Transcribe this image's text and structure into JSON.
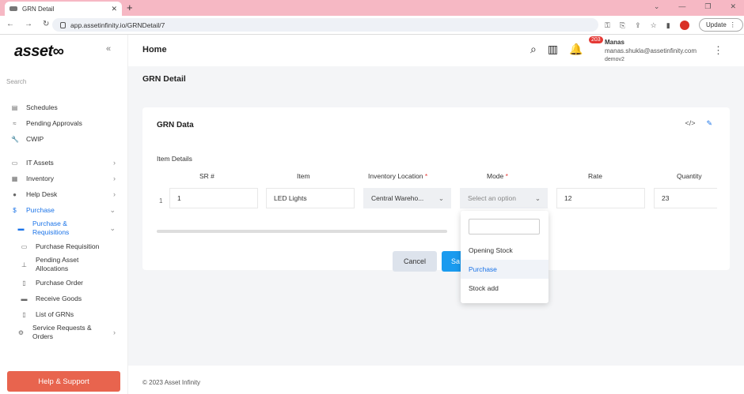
{
  "browser": {
    "tab_title": "GRN Detail",
    "url": "app.assetinfinity.io/GRNDetail/7",
    "update_label": "Update"
  },
  "sidebar": {
    "logo": "asset∞",
    "search_placeholder": "Search",
    "items": [
      {
        "label": "Schedules"
      },
      {
        "label": "Pending Approvals"
      },
      {
        "label": "CWIP"
      },
      {
        "label": "IT Assets"
      },
      {
        "label": "Inventory"
      },
      {
        "label": "Help Desk"
      },
      {
        "label": "Purchase"
      },
      {
        "label": "Purchase & Requisitions"
      },
      {
        "label": "Purchase Requisition"
      },
      {
        "label": "Pending Asset Allocations"
      },
      {
        "label": "Purchase Order"
      },
      {
        "label": "Receive Goods"
      },
      {
        "label": "List of GRNs"
      },
      {
        "label": "Service Requests & Orders"
      }
    ],
    "help_label": "Help & Support"
  },
  "topbar": {
    "title": "Home",
    "notification_count": "203",
    "user_name": "Manas",
    "user_email": "manas.shukla@assetinfinity.com",
    "user_org": "demov2"
  },
  "page": {
    "header": "GRN Detail",
    "card_title": "GRN Data",
    "section_label": "Item Details",
    "columns": [
      "SR #",
      "Item",
      "Inventory Location",
      "Mode",
      "Rate",
      "Quantity"
    ],
    "required_mark": "*",
    "row": {
      "index": "1",
      "sr": "1",
      "item": "LED Lights",
      "location": "Central Wareho...",
      "mode_placeholder": "Select an option",
      "rate": "12",
      "quantity": "23"
    },
    "cancel_label": "Cancel",
    "save_label": "Sa"
  },
  "dropdown": {
    "options": [
      "Opening Stock",
      "Purchase",
      "Stock add"
    ],
    "highlighted": "Purchase"
  },
  "footer": {
    "text": "© 2023  Asset Infinity"
  },
  "colors": {
    "accent": "#1a73e8",
    "help_button": "#e8644e",
    "save_button": "#1a9bef",
    "tab_bar": "#f6b8c4"
  }
}
